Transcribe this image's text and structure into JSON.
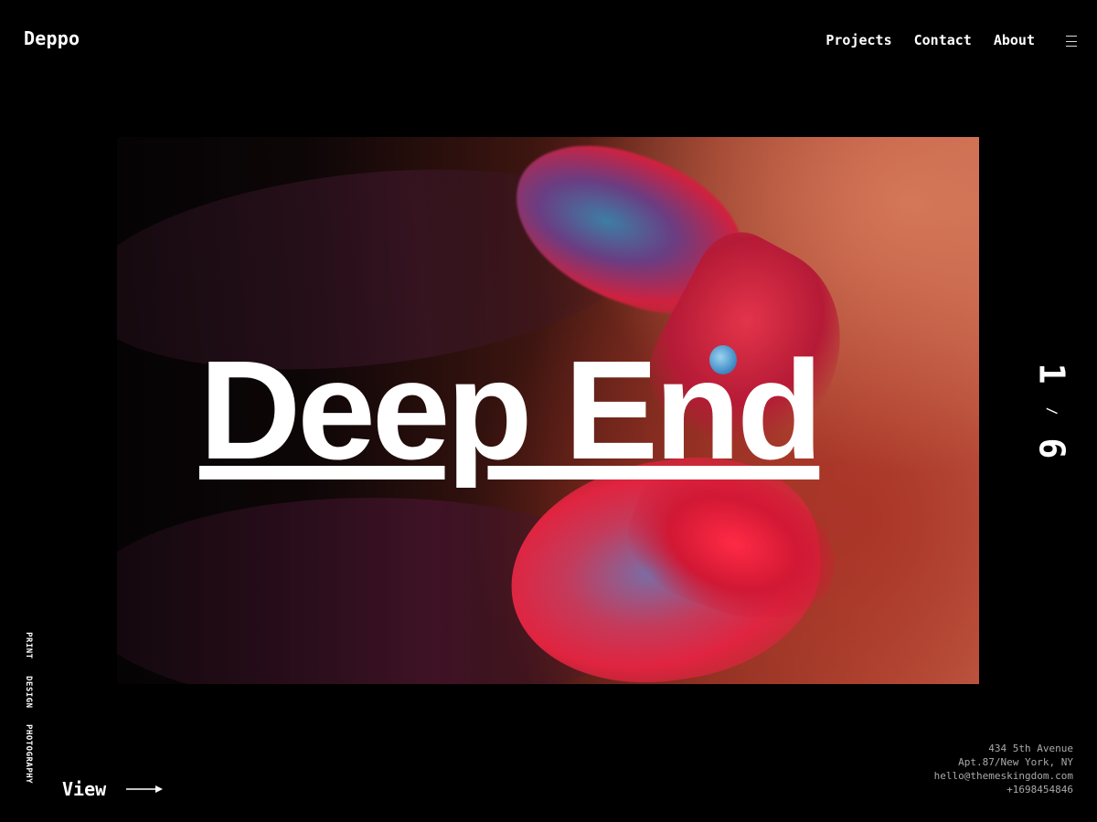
{
  "brand": {
    "logo": "Deppo"
  },
  "nav": {
    "items": [
      {
        "label": "Projects"
      },
      {
        "label": "Contact"
      },
      {
        "label": "About"
      }
    ],
    "menu_icon": "hamburger-icon"
  },
  "hero": {
    "title": "Deep End",
    "image_subject": "two hands lit in red and blue light against an orange-red background"
  },
  "slider": {
    "current": "1",
    "separator": "/",
    "total": "6"
  },
  "categories": [
    "PRINT",
    "DESIGN",
    "PHOTOGRAPHY"
  ],
  "cta": {
    "label": "View",
    "icon": "arrow-right-icon"
  },
  "contact": {
    "address_line1": "434 5th Avenue",
    "address_line2": "Apt.87/New York, NY",
    "email": "hello@themeskingdom.com",
    "phone": "+1698454846"
  },
  "colors": {
    "background": "#000000",
    "text": "#ffffff",
    "muted_text": "#a9a9a9",
    "hero_accent": "#c3654a"
  }
}
